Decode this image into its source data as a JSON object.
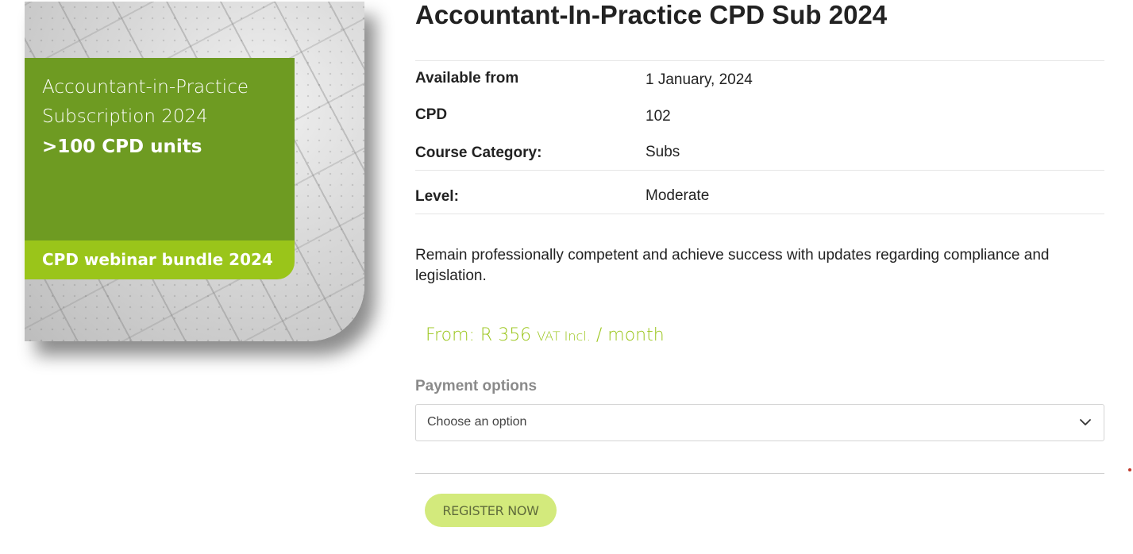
{
  "product_image": {
    "cover_line_1": "Accountant-in-Practice",
    "cover_line_2": "Subscription 2024",
    "cover_line_3": ">100 CPD units",
    "band_text": "CPD webinar bundle 2024"
  },
  "product": {
    "title": "Accountant-In-Practice CPD Sub 2024",
    "attributes": [
      {
        "label": "Available from",
        "value": "1 January, 2024"
      },
      {
        "label": "CPD",
        "value": "102"
      },
      {
        "label": "Course Category:",
        "value": "Subs"
      },
      {
        "label": "Level:",
        "value": "Moderate"
      }
    ],
    "description": "Remain professionally competent and achieve success with updates regarding compliance and legislation.",
    "price": {
      "prefix": "From: R 356",
      "vat": "VAT Incl.",
      "suffix": "/ month"
    }
  },
  "payment": {
    "label": "Payment options",
    "select_value": "Choose an option"
  },
  "actions": {
    "register_label": "REGISTER NOW"
  },
  "colors": {
    "brand_green": "#6e9b22",
    "accent_lime": "#9ac51a",
    "button_bg": "#d3ea7c"
  },
  "icons": {
    "select_chevron": "chevron-down-icon"
  }
}
